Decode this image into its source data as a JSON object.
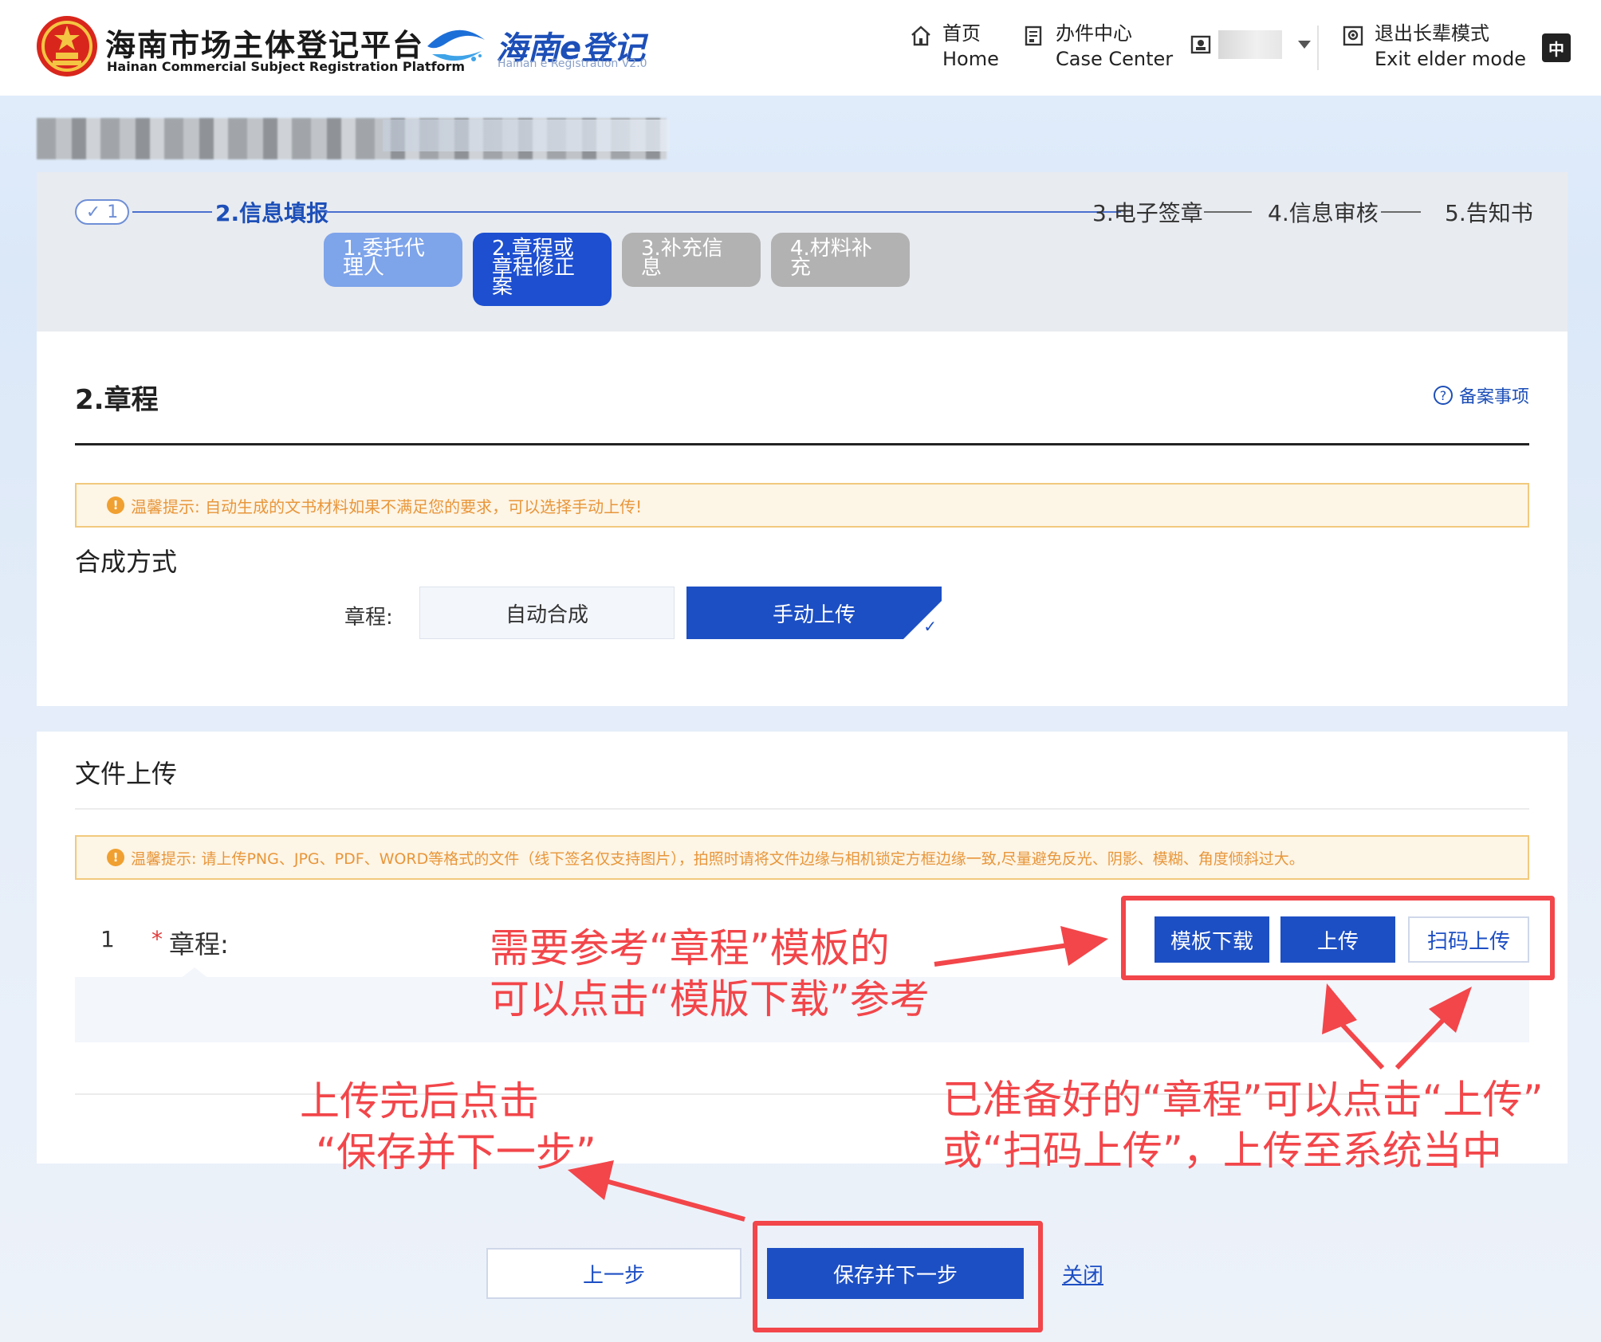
{
  "header": {
    "brand_cn": "海南市场主体登记平台",
    "brand_en": "Hainan Commercial Subject Registration Platform",
    "e_brand_cn": "海南e登记",
    "e_brand_en": "Hainan e Registration V2.0",
    "nav": [
      {
        "cn": "首页",
        "en": "Home",
        "icon": "home-icon"
      },
      {
        "cn": "办件中心",
        "en": "Case Center",
        "icon": "document-icon"
      },
      {
        "cn": "退出长辈模式",
        "en": "Exit elder mode",
        "icon": "elder-mode-icon"
      }
    ],
    "lang_icon_text": "中"
  },
  "steps": {
    "step1": "1",
    "step2": "2.信息填报",
    "step3": "3.电子签章",
    "step4": "4.信息审核",
    "step5": "5.告知书",
    "sub": [
      "1.委托代理人",
      "2.章程或章程修正案",
      "3.补充信息",
      "4.材料补充"
    ]
  },
  "card1": {
    "title": "2.章程",
    "help": "备案事项",
    "tip": "温馨提示: 自动生成的文书材料如果不满足您的要求，可以选择手动上传!",
    "section": "合成方式",
    "field_label": "章程:",
    "opt_auto": "自动合成",
    "opt_manual": "手动上传"
  },
  "card2": {
    "title": "文件上传",
    "tip": "温馨提示: 请上传PNG、JPG、PDF、WORD等格式的文件（线下签名仅支持图片），拍照时请将文件边缘与相机锁定方框边缘一致,尽量避免反光、阴影、模糊、角度倾斜过大。",
    "row_no": "1",
    "row_star": "*",
    "row_label": "章程:",
    "btn_template": "模板下载",
    "btn_upload": "上传",
    "btn_scan": "扫码上传"
  },
  "footer": {
    "prev": "上一步",
    "next": "保存并下一步",
    "close": "关闭"
  },
  "annotations": {
    "a1_line1": "需要参考“章程”模板的",
    "a1_line2": "可以点击“模版下载”参考",
    "a2_line1": "已准备好的“章程”可以点击“上传”",
    "a2_line2": "或“扫码上传”，上传至系统当中",
    "a3_line1": "上传完后点击",
    "a3_line2": "“保存并下一步”"
  },
  "colors": {
    "primary": "#1d4fc4",
    "annotation": "#f2464a",
    "tip_text": "#e8963a"
  }
}
